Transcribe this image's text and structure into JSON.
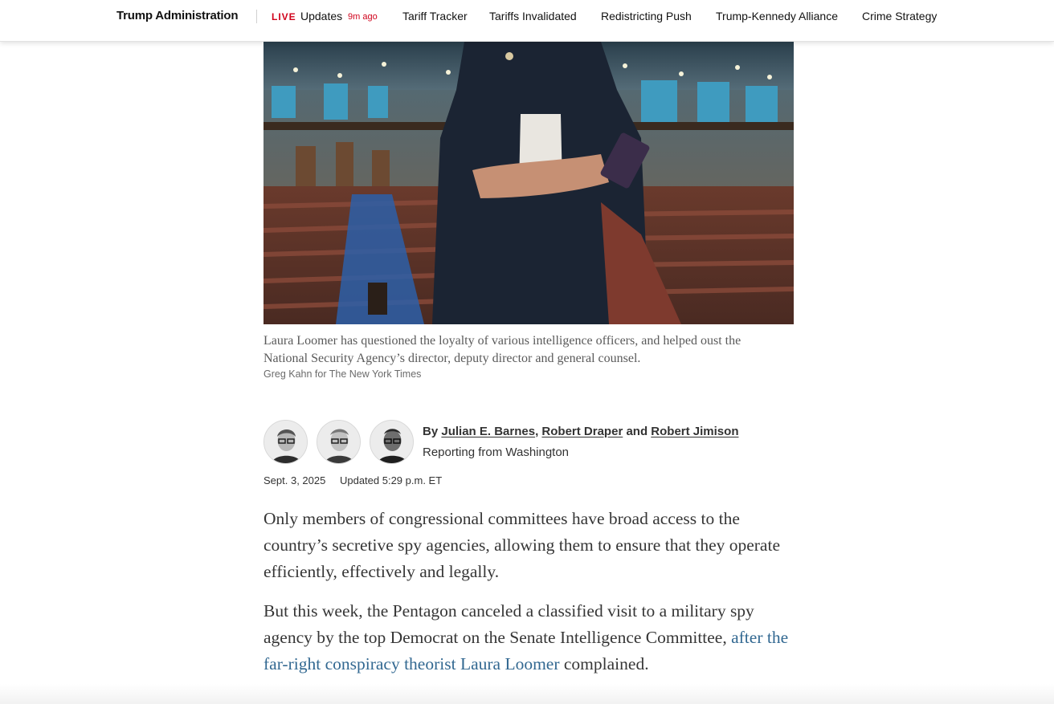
{
  "nav": {
    "section": "Trump Administration",
    "live_badge": "LIVE",
    "updates": "Updates",
    "updates_ago": "9m ago",
    "links": [
      "Tariff Tracker",
      "Tariffs Invalidated",
      "Redistricting Push",
      "Trump-Kennedy Alliance",
      "Crime Strategy"
    ]
  },
  "image": {
    "caption": "Laura Loomer has questioned the loyalty of various intelligence officers, and helped oust the National Security Agency’s director, deputy director and general counsel.",
    "credit": "Greg Kahn for The New York Times"
  },
  "byline": {
    "prefix": "By",
    "authors": [
      "Julian E. Barnes",
      "Robert Draper",
      "Robert Jimison"
    ],
    "separator_comma": ",",
    "separator_and": "and",
    "location": "Reporting from Washington"
  },
  "dates": {
    "published": "Sept. 3, 2025",
    "updated": "Updated 5:29 p.m. ET"
  },
  "body": {
    "p1": "Only members of congressional committees have broad access to the country’s secretive spy agencies, allowing them to ensure that they operate efficiently, effectively and legally.",
    "p2_before": "But this week, the Pentagon canceled a classified visit to a military spy agency by the top Democrat on the Senate Intelligence Committee,",
    "p2_link": "after the far-right conspiracy theorist Laura Loomer",
    "p2_after": "complained."
  },
  "colors": {
    "live_red": "#d0021b",
    "link_blue": "#326891"
  }
}
